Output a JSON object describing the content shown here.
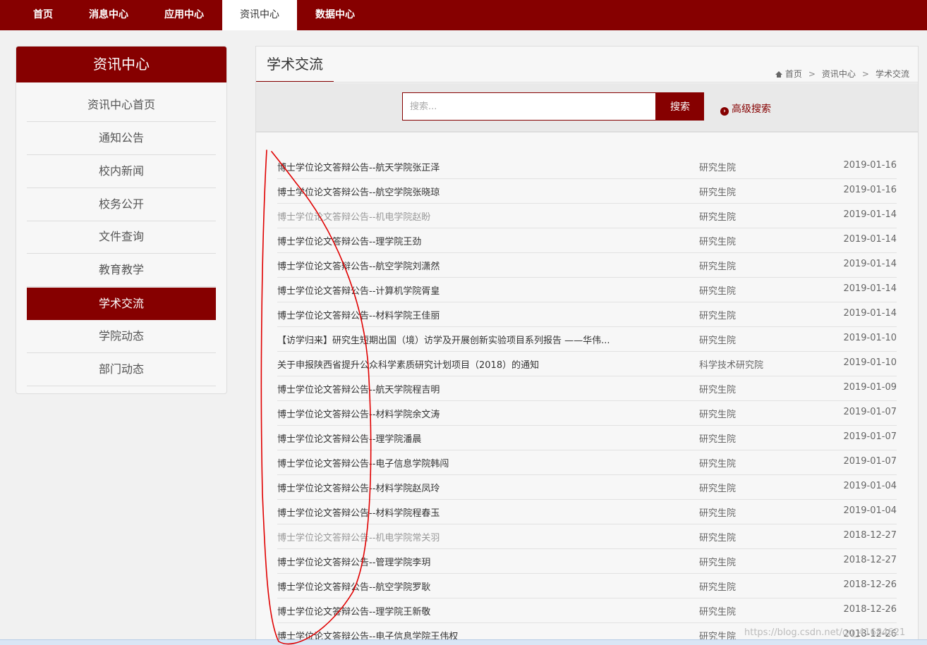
{
  "topnav": {
    "items": [
      {
        "label": "首页"
      },
      {
        "label": "消息中心"
      },
      {
        "label": "应用中心"
      },
      {
        "label": "资讯中心",
        "active": true
      },
      {
        "label": "数据中心"
      }
    ]
  },
  "sidebar": {
    "header": "资讯中心",
    "items": [
      {
        "label": "资讯中心首页"
      },
      {
        "label": "通知公告"
      },
      {
        "label": "校内新闻"
      },
      {
        "label": "校务公开"
      },
      {
        "label": "文件查询"
      },
      {
        "label": "教育教学"
      },
      {
        "label": "学术交流",
        "active": true
      },
      {
        "label": "学院动态"
      },
      {
        "label": "部门动态"
      }
    ]
  },
  "main": {
    "title": "学术交流",
    "breadcrumb": {
      "home": "首页",
      "section": "资讯中心",
      "current": "学术交流",
      "separator": ">"
    },
    "search": {
      "placeholder": "搜索...",
      "button": "搜索",
      "advanced": "高级搜索"
    },
    "rows": [
      {
        "title": "博士学位论文答辩公告--航天学院张正泽",
        "dept": "研究生院",
        "date": "2019-01-16"
      },
      {
        "title": "博士学位论文答辩公告--航空学院张晓琼",
        "dept": "研究生院",
        "date": "2019-01-16"
      },
      {
        "title": "博士学位论文答辩公告--机电学院赵盼",
        "dept": "研究生院",
        "date": "2019-01-14",
        "visited": true
      },
      {
        "title": "博士学位论文答辩公告--理学院王劲",
        "dept": "研究生院",
        "date": "2019-01-14"
      },
      {
        "title": "博士学位论文答辩公告--航空学院刘潇然",
        "dept": "研究生院",
        "date": "2019-01-14"
      },
      {
        "title": "博士学位论文答辩公告--计算机学院胥皇",
        "dept": "研究生院",
        "date": "2019-01-14"
      },
      {
        "title": "博士学位论文答辩公告--材料学院王佳丽",
        "dept": "研究生院",
        "date": "2019-01-14"
      },
      {
        "title": "【访学归来】研究生短期出国（境）访学及开展创新实验项目系列报告 ——华伟...",
        "dept": "研究生院",
        "date": "2019-01-10"
      },
      {
        "title": "关于申报陕西省提升公众科学素质研究计划项目（2018）的通知",
        "dept": "科学技术研究院",
        "date": "2019-01-10"
      },
      {
        "title": "博士学位论文答辩公告--航天学院程吉明",
        "dept": "研究生院",
        "date": "2019-01-09"
      },
      {
        "title": "博士学位论文答辩公告--材料学院余文涛",
        "dept": "研究生院",
        "date": "2019-01-07"
      },
      {
        "title": "博士学位论文答辩公告--理学院潘晨",
        "dept": "研究生院",
        "date": "2019-01-07"
      },
      {
        "title": "博士学位论文答辩公告--电子信息学院韩闯",
        "dept": "研究生院",
        "date": "2019-01-07"
      },
      {
        "title": "博士学位论文答辩公告--材料学院赵凤玲",
        "dept": "研究生院",
        "date": "2019-01-04"
      },
      {
        "title": "博士学位论文答辩公告--材料学院程春玉",
        "dept": "研究生院",
        "date": "2019-01-04"
      },
      {
        "title": "博士学位论文答辩公告--机电学院常关羽",
        "dept": "研究生院",
        "date": "2018-12-27",
        "visited": true
      },
      {
        "title": "博士学位论文答辩公告--管理学院李玥",
        "dept": "研究生院",
        "date": "2018-12-27"
      },
      {
        "title": "博士学位论文答辩公告--航空学院罗耿",
        "dept": "研究生院",
        "date": "2018-12-26"
      },
      {
        "title": "博士学位论文答辩公告--理学院王新敬",
        "dept": "研究生院",
        "date": "2018-12-26"
      },
      {
        "title": "博士学位论文答辩公告--电子信息学院王伟权",
        "dept": "研究生院",
        "date": "2018-12-26"
      }
    ]
  },
  "watermark": "https://blog.csdn.net/qq_41684621",
  "colors": {
    "brand": "#860000",
    "annotation": "#e00000"
  }
}
